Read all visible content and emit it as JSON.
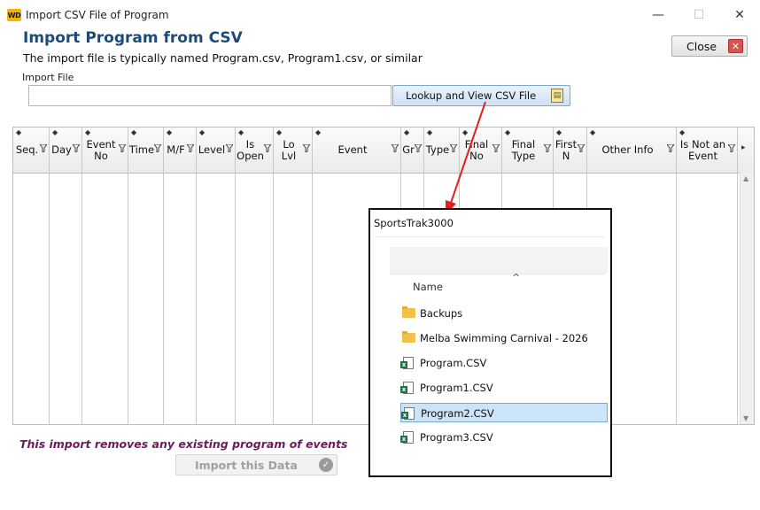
{
  "window": {
    "app_icon_text": "WD",
    "title": "Import CSV File of Program",
    "minimize": "—",
    "maximize": "☐",
    "close": "✕"
  },
  "header": {
    "heading": "Import Program from CSV",
    "subtext": "The import file is typically named Program.csv, Program1.csv, or similar",
    "close_label": "Close"
  },
  "import_file": {
    "label": "Import File",
    "value": "",
    "lookup_label": "Lookup and View CSV File"
  },
  "grid": {
    "columns": [
      {
        "label": "Seq."
      },
      {
        "label": "Day"
      },
      {
        "label": "Event No"
      },
      {
        "label": "Time"
      },
      {
        "label": "M/F"
      },
      {
        "label": "Level"
      },
      {
        "label": "Is Open"
      },
      {
        "label": "Lo Lvl"
      },
      {
        "label": "Event"
      },
      {
        "label": "Gr"
      },
      {
        "label": "Type"
      },
      {
        "label": "Final No"
      },
      {
        "label": "Final Type"
      },
      {
        "label": "First N"
      },
      {
        "label": "Other Info"
      },
      {
        "label": "Is Not an Event"
      }
    ]
  },
  "footer": {
    "warning": "This import removes any existing program of events",
    "import_label": "Import this Data"
  },
  "dialog": {
    "title": "SportsTrak3000",
    "column_name": "Name",
    "items": [
      {
        "name": "Backups",
        "kind": "folder",
        "selected": false
      },
      {
        "name": "Melba Swimming Carnival - 2026",
        "kind": "folder",
        "selected": false
      },
      {
        "name": "Program.CSV",
        "kind": "csv",
        "selected": false
      },
      {
        "name": "Program1.CSV",
        "kind": "csv",
        "selected": false
      },
      {
        "name": "Program2.CSV",
        "kind": "csv",
        "selected": true
      },
      {
        "name": "Program3.CSV",
        "kind": "csv",
        "selected": false
      }
    ]
  },
  "colors": {
    "heading": "#1e4a7a",
    "warning": "#6b1a5c",
    "annotation_arrow": "#e02020",
    "selection": "#cce4f7"
  }
}
